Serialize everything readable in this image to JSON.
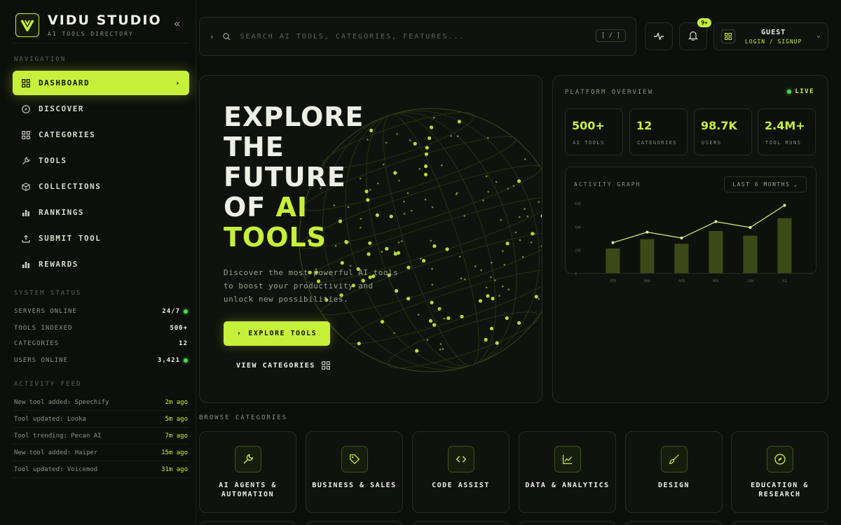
{
  "brand": {
    "title": "VIDU STUDIO",
    "subtitle": "AI TOOLS DIRECTORY",
    "collapse_icon": "double-chevron-left-icon"
  },
  "nav_label": "NAVIGATION",
  "nav": [
    {
      "label": "DASHBOARD",
      "icon": "grid-icon",
      "active": true
    },
    {
      "label": "DISCOVER",
      "icon": "compass-icon"
    },
    {
      "label": "CATEGORIES",
      "icon": "grid-icon"
    },
    {
      "label": "TOOLS",
      "icon": "wrench-icon"
    },
    {
      "label": "COLLECTIONS",
      "icon": "box-icon"
    },
    {
      "label": "RANKINGS",
      "icon": "bar-chart-icon"
    },
    {
      "label": "SUBMIT TOOL",
      "icon": "upload-icon"
    },
    {
      "label": "REWARDS",
      "icon": "bar-chart-icon"
    }
  ],
  "system_status": {
    "label": "SYSTEM STATUS",
    "rows": [
      {
        "label": "SERVERS ONLINE",
        "value": "24/7",
        "dot": true
      },
      {
        "label": "TOOLS INDEXED",
        "value": "500+"
      },
      {
        "label": "CATEGORIES",
        "value": "12"
      },
      {
        "label": "USERS ONLINE",
        "value": "3,421",
        "dot": true
      }
    ]
  },
  "activity_feed": {
    "label": "ACTIVITY FEED",
    "items": [
      {
        "text": "New tool added: Speechify",
        "time": "2m ago"
      },
      {
        "text": "Tool updated: Looka",
        "time": "5m ago"
      },
      {
        "text": "Tool trending: Pecan AI",
        "time": "7m ago"
      },
      {
        "text": "New tool added: Haiper",
        "time": "15m ago"
      },
      {
        "text": "Tool updated: Voicemod",
        "time": "31m ago"
      }
    ]
  },
  "search": {
    "placeholder": "SEARCH AI TOOLS, CATEGORIES, FEATURES...",
    "shortcut": "[ / ]"
  },
  "header": {
    "notifications_badge": "9+",
    "user_name": "GUEST",
    "user_action": "LOGIN / SIGNUP"
  },
  "hero": {
    "title_lines": [
      "EXPLORE",
      "THE",
      "FUTURE",
      "OF "
    ],
    "title_highlight_1": "AI",
    "title_highlight_2": "TOOLS",
    "description": "Discover the most powerful AI tools to boost your productivity and unlock new possibilities.",
    "primary_button": "EXPLORE TOOLS",
    "secondary_link": "VIEW CATEGORIES"
  },
  "overview": {
    "label": "PLATFORM OVERVIEW",
    "live": "LIVE",
    "stats": [
      {
        "value": "500+",
        "label": "AI TOOLS"
      },
      {
        "value": "12",
        "label": "CATEGORIES"
      },
      {
        "value": "98.7K",
        "label": "USERS"
      },
      {
        "value": "2.4M+",
        "label": "TOOL RUNS"
      }
    ],
    "graph_label": "ACTIVITY GRAPH",
    "range": "LAST 6 MONTHS"
  },
  "chart_data": {
    "type": "bar",
    "categories": [
      "FEB",
      "MAR",
      "APR",
      "MAY",
      "JUN",
      "JUL"
    ],
    "y_ticks": [
      "60K",
      "40K",
      "20K",
      "0"
    ],
    "ylim": [
      0,
      60
    ],
    "series": [
      {
        "values": [
          21,
          29,
          25,
          36,
          32,
          47
        ]
      },
      {
        "values": [
          26,
          35,
          30,
          44,
          39,
          58
        ]
      }
    ],
    "grid": false
  },
  "categories": {
    "label": "BROWSE CATEGORIES",
    "items": [
      {
        "name": "AI AGENTS & AUTOMATION",
        "icon": "wrench-icon"
      },
      {
        "name": "BUSINESS & SALES",
        "icon": "tag-icon"
      },
      {
        "name": "CODE ASSIST",
        "icon": "code-icon"
      },
      {
        "name": "DATA & ANALYTICS",
        "icon": "line-chart-icon"
      },
      {
        "name": "DESIGN",
        "icon": "brush-icon"
      },
      {
        "name": "EDUCATION & RESEARCH",
        "icon": "compass-icon"
      }
    ]
  },
  "colors": {
    "accent": "#c7f03a",
    "background": "#0d0f0b",
    "panel": "#10130d",
    "status_green": "#4fd65a"
  }
}
